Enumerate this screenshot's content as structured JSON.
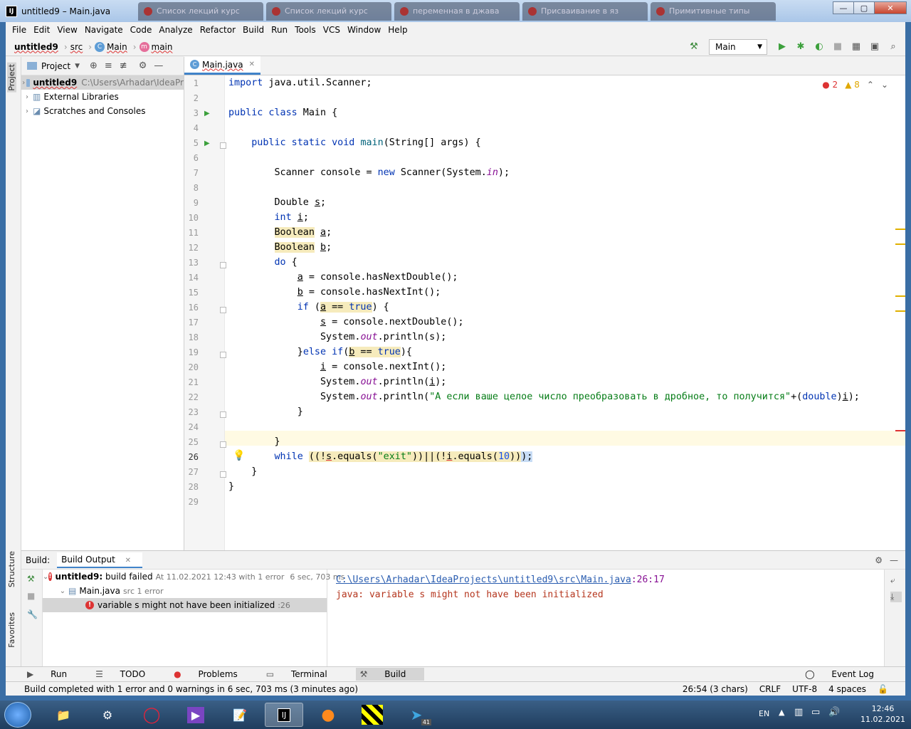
{
  "window": {
    "title": "untitled9 – Main.java",
    "minimize": "—",
    "maximize": "▢",
    "close": "✕"
  },
  "browser_tabs": [
    "Список лекций курс",
    "Список лекций курс",
    "переменная в джава",
    "Присваивание в яз",
    "Примитивные типы"
  ],
  "menu": [
    "File",
    "Edit",
    "View",
    "Navigate",
    "Code",
    "Analyze",
    "Refactor",
    "Build",
    "Run",
    "Tools",
    "VCS",
    "Window",
    "Help"
  ],
  "breadcrumbs": {
    "project": "untitled9",
    "src": "src",
    "class": "Main",
    "method": "main"
  },
  "run_config": "Main",
  "side_tabs": {
    "project": "Project",
    "structure": "Structure",
    "favorites": "Favorites"
  },
  "project_panel": {
    "title": "Project",
    "items": [
      {
        "label": "untitled9",
        "path": "C:\\Users\\Arhadar\\IdeaPr"
      },
      {
        "label": "External Libraries"
      },
      {
        "label": "Scratches and Consoles"
      }
    ]
  },
  "editor": {
    "tab": "Main.java",
    "errors": "2",
    "warnings": "8"
  },
  "code_lines": [
    "1",
    "2",
    "3",
    "4",
    "5",
    "6",
    "7",
    "8",
    "9",
    "10",
    "11",
    "12",
    "13",
    "14",
    "15",
    "16",
    "17",
    "18",
    "19",
    "20",
    "21",
    "22",
    "23",
    "24",
    "25",
    "26",
    "27",
    "28",
    "29"
  ],
  "build": {
    "label": "Build:",
    "tab": "Build Output",
    "root": "untitled9:",
    "root_status": "build failed",
    "root_meta": "At 11.02.2021 12:43 with 1 error",
    "root_time": "6 sec, 703 ms",
    "file": "Main.java",
    "file_meta": "src 1 error",
    "error": "variable s might not have been initialized",
    "error_line": ":26",
    "out_path": "C:\\Users\\Arhadar\\IdeaProjects\\untitled9\\src\\Main.java",
    "out_pos": ":26:17",
    "out_msg": "java: variable s might not have been initialized"
  },
  "tool_windows": [
    "Run",
    "TODO",
    "Problems",
    "Terminal",
    "Build"
  ],
  "event_log": "Event Log",
  "status": {
    "message": "Build completed with 1 error and 0 warnings in 6 sec, 703 ms (3 minutes ago)",
    "pos": "26:54 (3 chars)",
    "eol": "CRLF",
    "enc": "UTF-8",
    "indent": "4 spaces"
  },
  "taskbar": {
    "lang": "EN",
    "time": "12:46",
    "date": "11.02.2021",
    "badge": "41"
  }
}
